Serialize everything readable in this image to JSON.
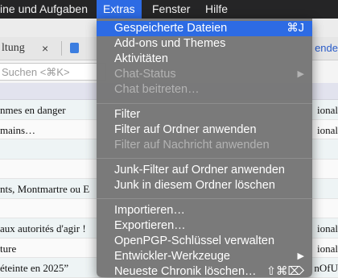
{
  "menubar": {
    "items": [
      {
        "label": "ine und Aufgaben"
      },
      {
        "label": "Extras"
      },
      {
        "label": "Fenster"
      },
      {
        "label": "Hilfe"
      }
    ]
  },
  "toolbar": {
    "tab_label": "ltung",
    "close_glyph": "×",
    "right_label": "ende"
  },
  "search": {
    "placeholder": "Suchen <⌘K>"
  },
  "messages": [
    {
      "left": "nmes en danger",
      "right": "ional"
    },
    {
      "left": "mains…",
      "right": "ional"
    },
    {
      "left": "",
      "right": ""
    },
    {
      "left": "",
      "right": ""
    },
    {
      "left": "nts, Montmartre ou E",
      "right": ""
    },
    {
      "left": "",
      "right": ""
    },
    {
      "left": "aux autorités d'agir !",
      "right": "ional"
    },
    {
      "left": "ture",
      "right": "ional"
    },
    {
      "left": "éteinte en 2025”",
      "right": "nOfU"
    }
  ],
  "extras_menu": {
    "items": [
      {
        "label": "Gespeicherte Dateien",
        "shortcut": "⌘J",
        "state": "highlighted"
      },
      {
        "label": "Add-ons und Themes",
        "state": "enabled"
      },
      {
        "label": "Aktivitäten",
        "state": "enabled"
      },
      {
        "label": "Chat-Status",
        "state": "disabled",
        "submenu": "▶"
      },
      {
        "label": "Chat beitreten…",
        "state": "disabled"
      },
      {
        "label": "Filter",
        "state": "enabled"
      },
      {
        "label": "Filter auf Ordner anwenden",
        "state": "enabled"
      },
      {
        "label": "Filter auf Nachricht anwenden",
        "state": "disabled"
      },
      {
        "label": "Junk-Filter auf Ordner anwenden",
        "state": "enabled"
      },
      {
        "label": "Junk in diesem Ordner löschen",
        "state": "enabled"
      },
      {
        "label": "Importieren…",
        "state": "enabled"
      },
      {
        "label": "Exportieren…",
        "state": "enabled"
      },
      {
        "label": "OpenPGP-Schlüssel verwalten",
        "state": "enabled"
      },
      {
        "label": "Entwickler-Werkzeuge",
        "state": "enabled",
        "submenu": "▶"
      },
      {
        "label": "Neueste Chronik löschen…",
        "shortcut": "⇧⌘⌦",
        "state": "enabled"
      }
    ]
  },
  "colors": {
    "highlight": "#2d6be4",
    "menu_bg": "#767676",
    "menubar_bg": "#252526"
  }
}
